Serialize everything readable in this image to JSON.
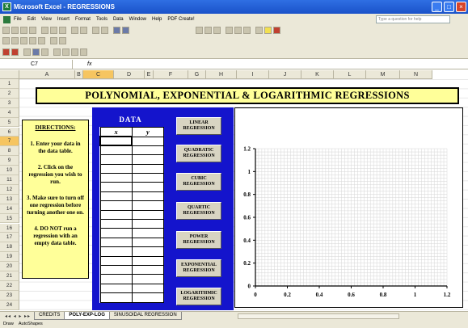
{
  "window": {
    "title": "Microsoft Excel - REGRESSIONS"
  },
  "menu": {
    "items": [
      "File",
      "Edit",
      "View",
      "Insert",
      "Format",
      "Tools",
      "Data",
      "Window",
      "Help",
      "PDF Create!"
    ],
    "help_placeholder": "Type a question for help"
  },
  "formula_bar": {
    "name_box": "C7",
    "fx": "fx"
  },
  "columns": [
    "A",
    "B",
    "C",
    "D",
    "E",
    "F",
    "G",
    "H",
    "I",
    "J",
    "K",
    "L",
    "M",
    "N"
  ],
  "rows": [
    "1",
    "2",
    "3",
    "4",
    "5",
    "6",
    "7",
    "8",
    "9",
    "10",
    "11",
    "12",
    "13",
    "14",
    "15",
    "16",
    "17",
    "18",
    "19",
    "20",
    "21",
    "22",
    "23",
    "24"
  ],
  "banner": "POLYNOMIAL, EXPONENTIAL & LOGARITHMIC REGRESSIONS",
  "directions": {
    "heading": "DIRECTIONS:",
    "steps": [
      "1. Enter your data in the data table.",
      "2. Click on the regression you wish to run.",
      "3. Make sure to turn off one regression before turning another one on.",
      "4. DO NOT run a regression with an empty data table."
    ]
  },
  "data_panel": {
    "title": "DATA",
    "col_x": "x",
    "col_y": "y"
  },
  "buttons": [
    "LINEAR REGRESSION",
    "QUADRATIC REGRESSION",
    "CUBIC REGRESSION",
    "QUARTIC REGRESSION",
    "POWER REGRESSION",
    "EXPONENTIAL REGRESSION",
    "LOGARITHMIC REGRESSION"
  ],
  "chart_data": {
    "type": "scatter",
    "series": [],
    "xlim": [
      0,
      1.2
    ],
    "ylim": [
      0,
      1.2
    ],
    "x_ticks": [
      "0",
      "0.2",
      "0.4",
      "0.6",
      "0.8",
      "1",
      "1.2"
    ],
    "y_ticks": [
      "0",
      "0.2",
      "0.4",
      "0.6",
      "0.8",
      "1",
      "1.2"
    ],
    "grid": true
  },
  "sheet_tabs": [
    "CREDITS",
    "POLY-EXP-LOG",
    "SINUSOIDAL REGRESSION"
  ],
  "draw_bar": {
    "draw": "Draw",
    "autoshapes": "AutoShapes"
  }
}
